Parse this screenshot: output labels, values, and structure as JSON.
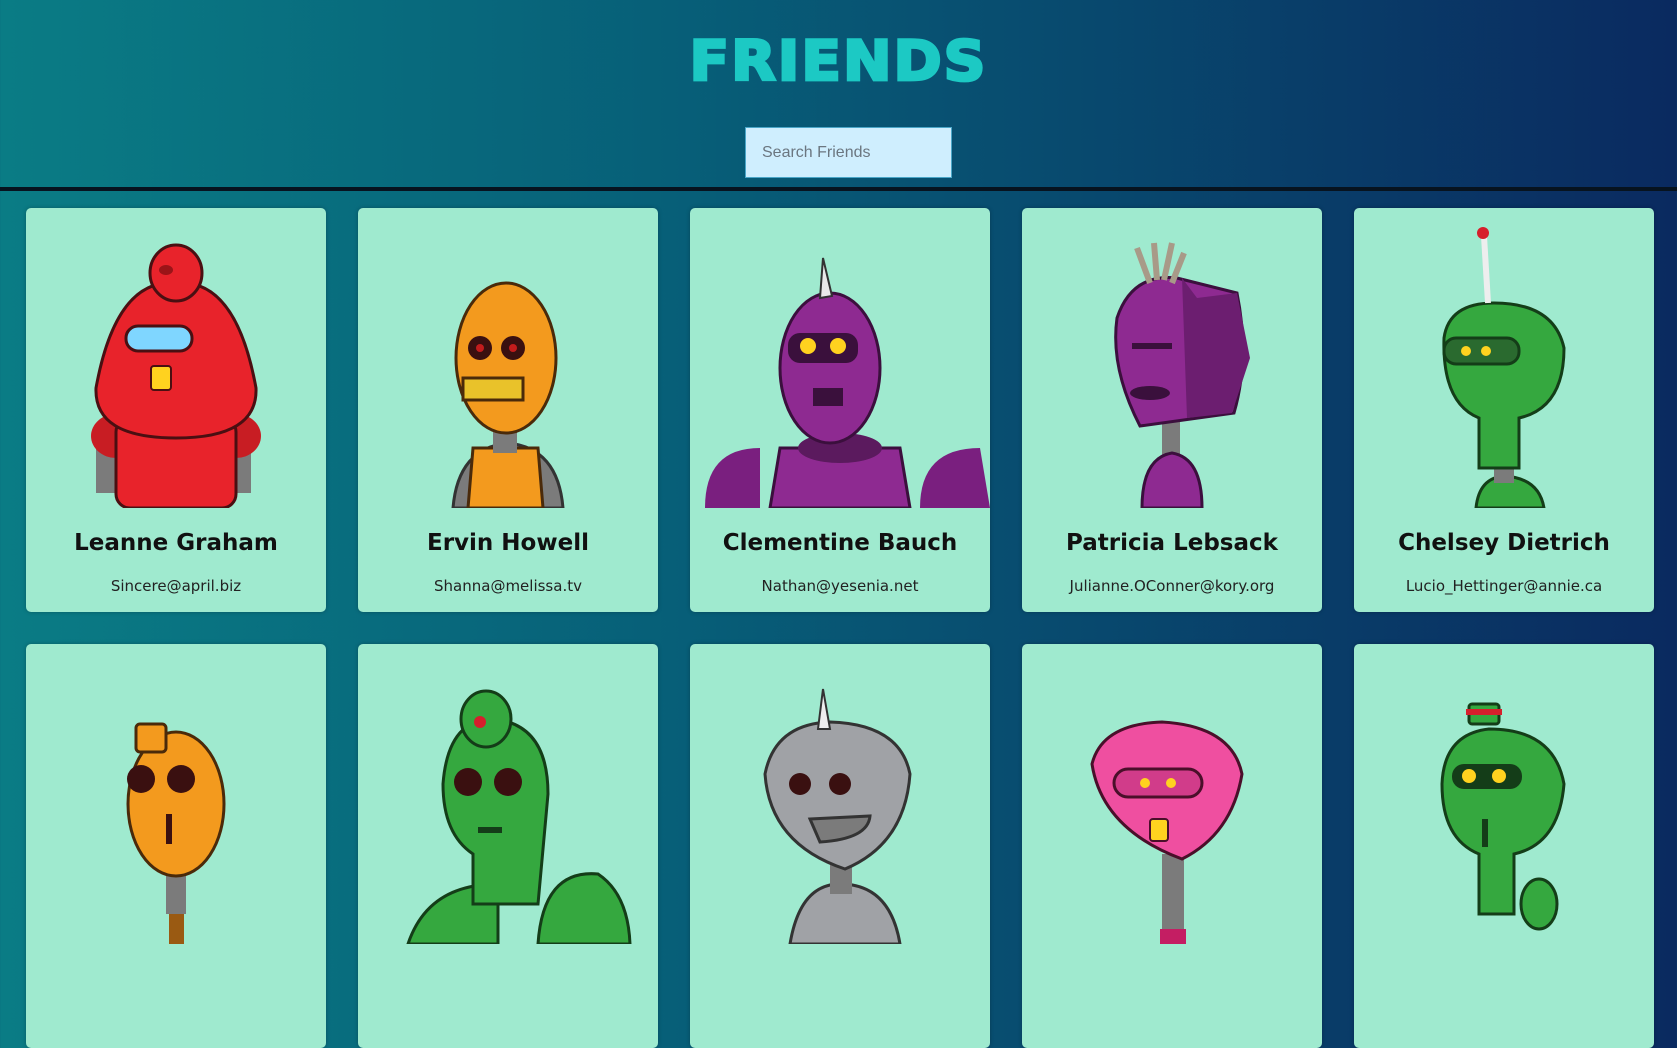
{
  "app": {
    "title": "FRIENDS",
    "search_placeholder": "Search Friends"
  },
  "colors": {
    "title": "#1cc9c4",
    "card_bg": "#9feacf",
    "search_bg": "#cfeefe"
  },
  "robots": [
    {
      "name": "Leanne Graham",
      "email": "Sincere@april.biz",
      "color": "#e8232b"
    },
    {
      "name": "Ervin Howell",
      "email": "Shanna@melissa.tv",
      "color": "#f39a1e"
    },
    {
      "name": "Clementine Bauch",
      "email": "Nathan@yesenia.net",
      "color": "#8e2a91"
    },
    {
      "name": "Patricia Lebsack",
      "email": "Julianne.OConner@kory.org",
      "color": "#8e2a91"
    },
    {
      "name": "Chelsey Dietrich",
      "email": "Lucio_Hettinger@annie.ca",
      "color": "#35a83f"
    },
    {
      "color": "#f39a1e"
    },
    {
      "color": "#35a83f"
    },
    {
      "color": "#a0a2a6"
    },
    {
      "color": "#ef4fa0"
    },
    {
      "color": "#35a83f"
    }
  ]
}
